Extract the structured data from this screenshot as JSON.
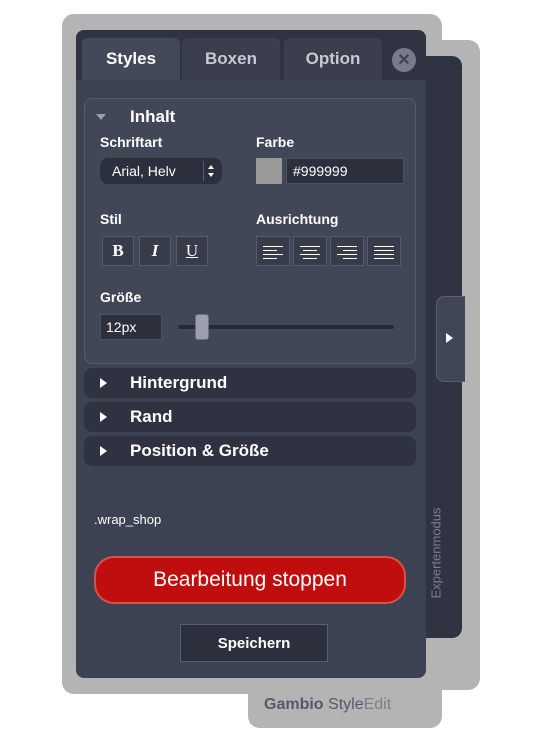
{
  "tabs": [
    {
      "label": "Styles",
      "active": true
    },
    {
      "label": "Boxen",
      "active": false
    },
    {
      "label": "Option",
      "active": false
    }
  ],
  "close_icon": "close-icon",
  "inhalt": {
    "title": "Inhalt",
    "font_label": "Schriftart",
    "font_value": "Arial, Helv",
    "color_label": "Farbe",
    "color_swatch": "#999999",
    "color_value": "#999999",
    "style_label": "Stil",
    "bold": "B",
    "italic": "I",
    "underline": "U",
    "align_label": "Ausrichtung",
    "align_buttons": [
      "align-left-icon",
      "align-center-icon",
      "align-right-icon",
      "align-justify-icon"
    ],
    "size_label": "Größe",
    "size_value": "12px",
    "size_slider_fraction": 0.11
  },
  "sections": [
    "Hintergrund",
    "Rand",
    "Position & Größe"
  ],
  "selector": ".wrap_shop",
  "stop_button": "Bearbeitung stoppen",
  "save_button": "Speichern",
  "side_label": "Expertenmodus",
  "logo": {
    "brand": "Gambio",
    "product": "Style",
    "suffix": "Edit"
  },
  "colors": {
    "panel": "#3d4252",
    "accent_red": "#c00d0d",
    "frame": "#b4b4b4"
  }
}
